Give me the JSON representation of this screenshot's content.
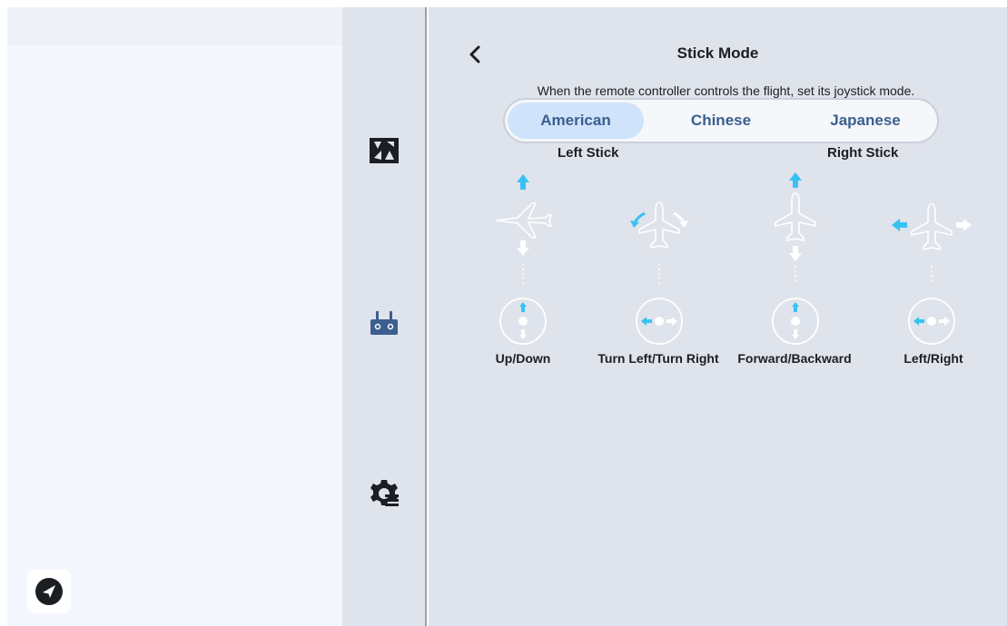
{
  "page": {
    "title": "Stick Mode",
    "description": "When the remote controller controls the flight, set its joystick mode."
  },
  "modes": [
    "American",
    "Chinese",
    "Japanese"
  ],
  "selected_mode": "American",
  "stick_labels": {
    "left": "Left Stick",
    "right": "Right Stick"
  },
  "controls": [
    {
      "label": "Up/Down",
      "icon": "aircraft-up-down-icon"
    },
    {
      "label": "Turn Left/Turn Right",
      "icon": "aircraft-yaw-icon"
    },
    {
      "label": "Forward/Backward",
      "icon": "aircraft-pitch-icon"
    },
    {
      "label": "Left/Right",
      "icon": "aircraft-roll-icon"
    }
  ],
  "rail": {
    "icons": [
      "flight-view-icon",
      "remote-controller-icon",
      "settings-gear-icon"
    ]
  },
  "colors": {
    "accent": "#38c2f4",
    "selected_bg": "#cfe3fb",
    "text_blue": "#3a5f8d"
  }
}
